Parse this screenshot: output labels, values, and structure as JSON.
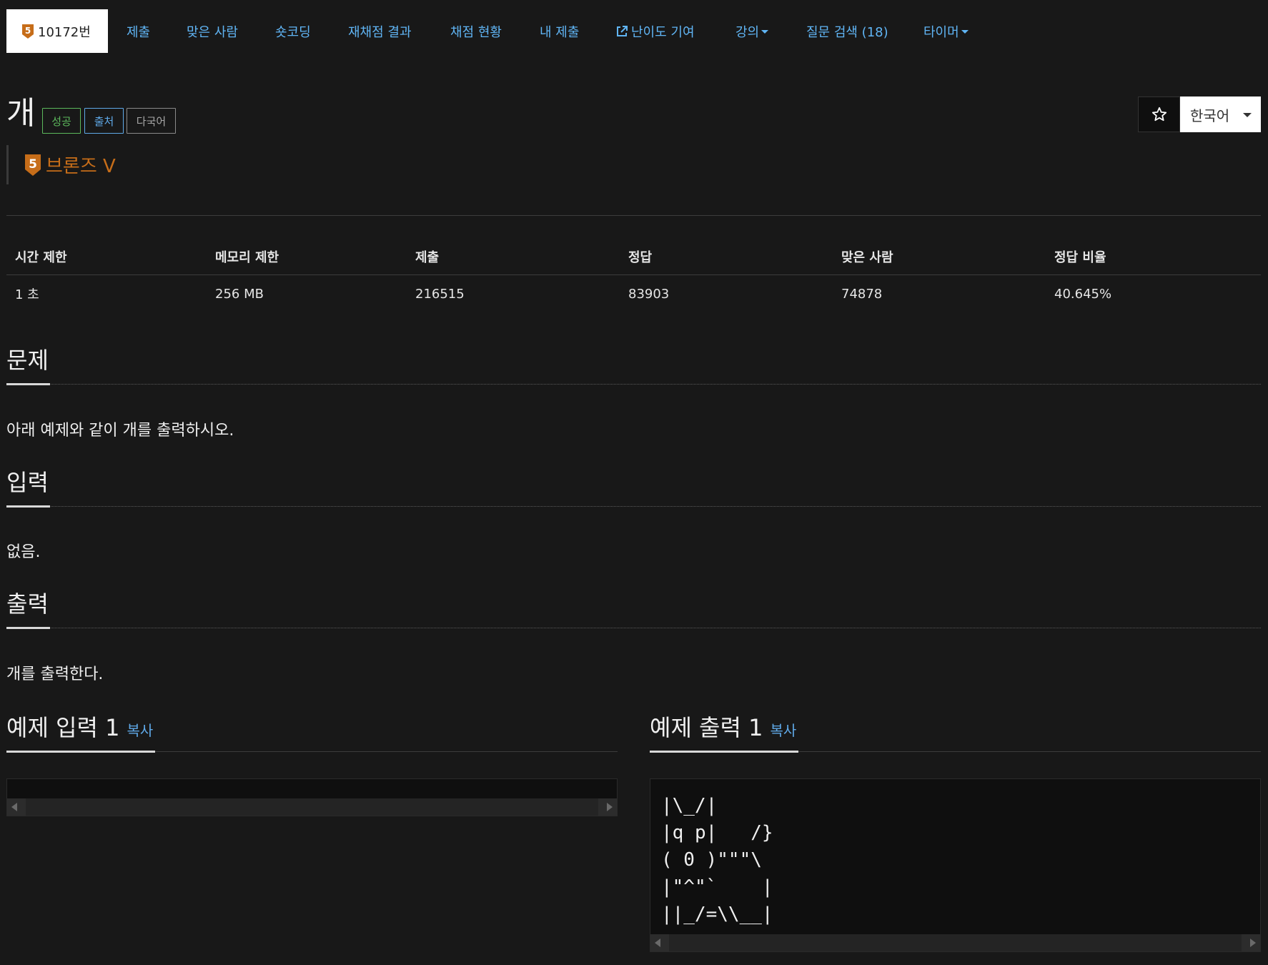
{
  "nav": {
    "problem_id": "10172번",
    "tier_badge_digit": "5",
    "items": [
      "제출",
      "맞은 사람",
      "숏코딩",
      "재채점 결과",
      "채점 현황",
      "내 제출",
      "난이도 기여",
      "강의",
      "질문 검색 (18)",
      "타이머"
    ]
  },
  "problem": {
    "title": "개",
    "labels": {
      "success": "성공",
      "source": "출처",
      "multilang": "다국어"
    },
    "tier": {
      "digit": "5",
      "name": "브론즈 V",
      "color": "#c66d19"
    },
    "language": "한국어"
  },
  "info": {
    "headers": [
      "시간 제한",
      "메모리 제한",
      "제출",
      "정답",
      "맞은 사람",
      "정답 비율"
    ],
    "values": [
      "1 초",
      "256 MB",
      "216515",
      "83903",
      "74878",
      "40.645%"
    ]
  },
  "sections": {
    "problem": {
      "title": "문제",
      "body": "아래 예제와 같이 개를 출력하시오."
    },
    "input": {
      "title": "입력",
      "body": "없음."
    },
    "output": {
      "title": "출력",
      "body": "개를 출력한다."
    }
  },
  "samples": {
    "input_title": "예제 입력 1",
    "output_title": "예제 출력 1",
    "copy_label": "복사",
    "input_text": "",
    "output_text": "|\\_/|\n|q p|   /}\n( 0 )\"\"\"\\\n|\"^\"`    |\n||_/=\\\\__|"
  },
  "colors": {
    "background": "#181818",
    "link": "#60b5f5",
    "success": "#5cb85c",
    "bronze": "#c66d19"
  }
}
